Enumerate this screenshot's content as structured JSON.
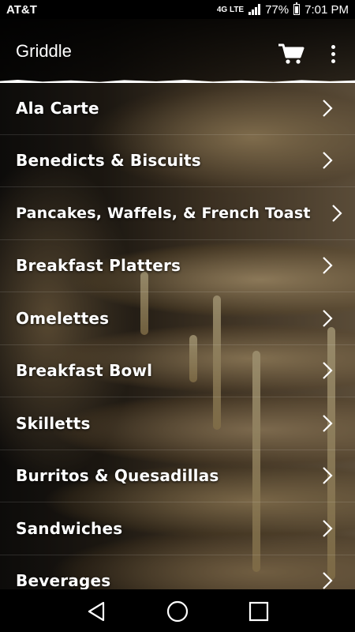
{
  "status_bar": {
    "carrier": "AT&T",
    "network": "4G LTE",
    "battery": "77%",
    "time": "7:01 PM"
  },
  "app_bar": {
    "title": "Griddle",
    "cart_icon": "shopping-cart-icon",
    "overflow_icon": "more-vert-icon"
  },
  "menu": {
    "items": [
      {
        "label": "Ala Carte"
      },
      {
        "label": "Benedicts & Biscuits"
      },
      {
        "label": "Pancakes, Waffels, & French Toast"
      },
      {
        "label": "Breakfast Platters"
      },
      {
        "label": "Omelettes"
      },
      {
        "label": "Breakfast Bowl"
      },
      {
        "label": "Skilletts"
      },
      {
        "label": "Burritos & Quesadillas"
      },
      {
        "label": "Sandwiches"
      },
      {
        "label": "Beverages"
      }
    ],
    "chevron_icon": "chevron-right-icon"
  },
  "nav_bar": {
    "back_icon": "back-triangle-icon",
    "home_icon": "home-circle-icon",
    "recents_icon": "recents-square-icon"
  },
  "colors": {
    "text": "#ffffff",
    "bars": "#000000"
  }
}
